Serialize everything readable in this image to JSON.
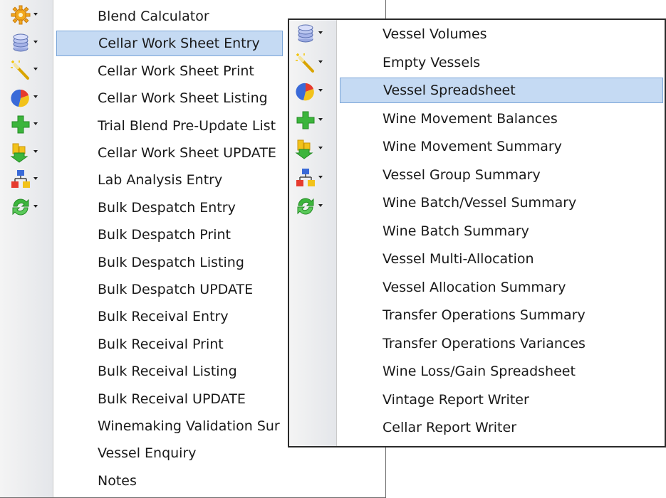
{
  "main_menu": {
    "toolbar_icons": [
      "gear-icon",
      "database-icon",
      "magic-wand-icon",
      "pie-chart-icon",
      "add-icon",
      "transfer-icon",
      "hierarchy-icon",
      "refresh-icon"
    ],
    "items": [
      "Blend Calculator",
      "Cellar Work Sheet Entry",
      "Cellar Work Sheet Print",
      "Cellar Work Sheet Listing",
      "Trial Blend Pre-Update List",
      "Cellar Work Sheet UPDATE",
      "Lab Analysis Entry",
      "Bulk Despatch Entry",
      "Bulk Despatch Print",
      "Bulk Despatch Listing",
      "Bulk Despatch UPDATE",
      "Bulk Receival Entry",
      "Bulk Receival Print",
      "Bulk Receival Listing",
      "Bulk Receival UPDATE",
      "Winemaking Validation Sur",
      "Vessel Enquiry",
      "Notes"
    ],
    "selected_index": 1
  },
  "submenu": {
    "toolbar_icons": [
      "database-icon",
      "magic-wand-icon",
      "pie-chart-icon",
      "add-icon",
      "transfer-icon",
      "hierarchy-icon",
      "refresh-icon"
    ],
    "items": [
      "Vessel Volumes",
      "Empty Vessels",
      "Vessel Spreadsheet",
      "Wine Movement Balances",
      "Wine Movement Summary",
      "Vessel Group Summary",
      "Wine Batch/Vessel Summary",
      "Wine Batch Summary",
      "Vessel Multi-Allocation",
      "Vessel Allocation Summary",
      "Transfer Operations Summary",
      "Transfer Operations Variances",
      "Wine Loss/Gain Spreadsheet",
      "Vintage Report Writer",
      "Cellar Report Writer"
    ],
    "selected_index": 2
  },
  "colors": {
    "selection_fill": "#c5daf3",
    "selection_border": "#7aa5d8"
  }
}
